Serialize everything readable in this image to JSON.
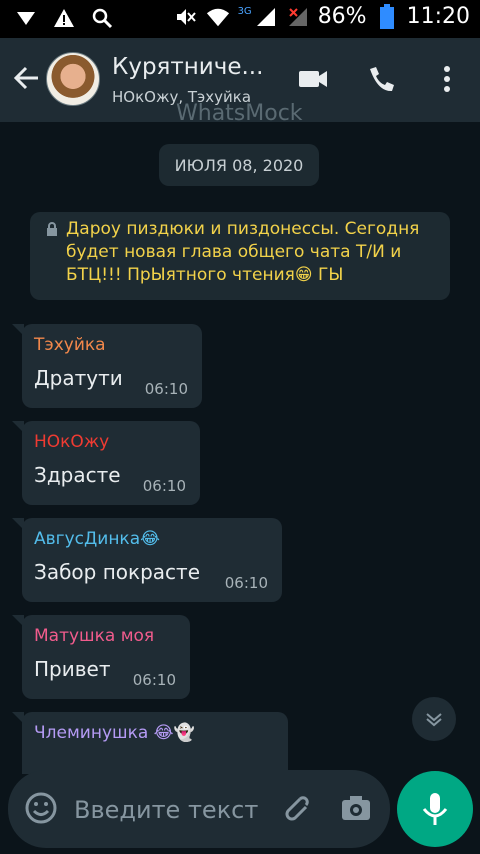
{
  "status_bar": {
    "network_badge": "3G",
    "battery_text": "86%",
    "clock": "11:20"
  },
  "header": {
    "title": "Курятниче...",
    "subtitle": "НОкОжу, Тэхуйка",
    "watermark": "WhatsMock"
  },
  "chat": {
    "date_label": "ИЮЛЯ 08, 2020",
    "system_message": "Дароу пиздюки и пиздонессы. Сегодня будет новая глава общего чата Т/И и БТЦ!!! ПрЫятного чтения😁 ГЫ",
    "messages": [
      {
        "sender": "Тэхуйка",
        "sender_color": "#f2884b",
        "text": "Дратути",
        "time": "06:10"
      },
      {
        "sender": "НОкОжу",
        "sender_color": "#ef3b32",
        "text": "Здрасте",
        "time": "06:10"
      },
      {
        "sender": "АвгусДинка😂",
        "sender_color": "#53bdeb",
        "text": "Забор покрасте",
        "time": "06:10"
      },
      {
        "sender": "Матушка моя",
        "sender_color": "#f15c8d",
        "text": "Привет",
        "time": "06:10"
      },
      {
        "sender": "Члеминушка 😂👻",
        "sender_color": "#b59bf5",
        "text": "",
        "time": ""
      }
    ]
  },
  "composer": {
    "placeholder": "Введите текст"
  },
  "icons": [
    "signal-icon",
    "warning-icon",
    "search-icon",
    "mute-icon",
    "wifi-icon",
    "battery-icon",
    "back-arrow-icon",
    "video-call-icon",
    "voice-call-icon",
    "more-options-icon",
    "lock-icon",
    "emoji-icon",
    "attach-icon",
    "camera-icon",
    "mic-icon",
    "chevron-down-icon"
  ]
}
